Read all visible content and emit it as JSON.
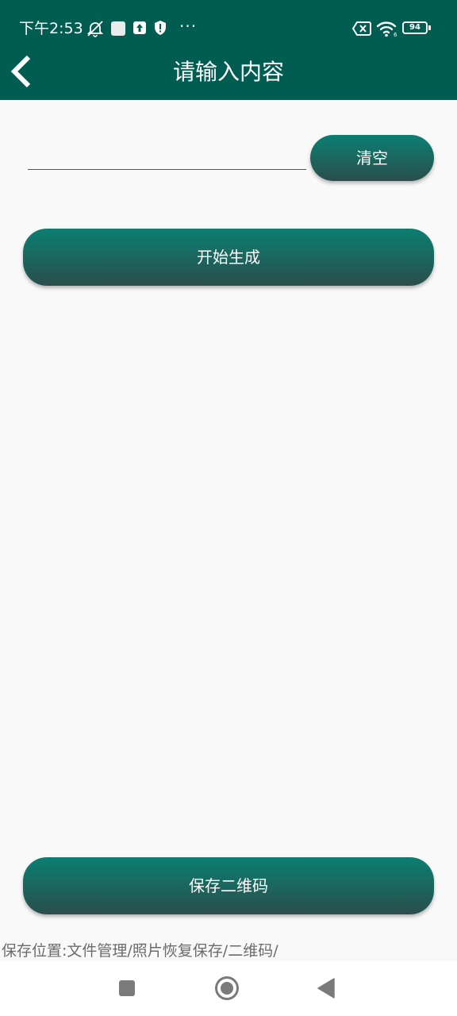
{
  "status_bar": {
    "time": "下午2:53",
    "more": "···",
    "battery_level": "94"
  },
  "header": {
    "title": "请输入内容"
  },
  "input": {
    "value": "",
    "placeholder": ""
  },
  "buttons": {
    "clear_label": "清空",
    "generate_label": "开始生成",
    "save_label": "保存二维码"
  },
  "footer": {
    "save_location": "保存位置:文件管理/照片恢复保存/二维码/"
  },
  "colors": {
    "app_bar": "#015c52",
    "button_top": "#0b7f72",
    "button_bottom": "#2a4e4b",
    "background": "#f9f9f9"
  },
  "icons": {
    "status": [
      "mute-bell-icon",
      "notification-square-icon",
      "upload-icon",
      "shield-icon",
      "sim-error-icon",
      "wifi-icon",
      "battery-icon"
    ],
    "back": "chevron-left-icon",
    "nav": [
      "recent-apps-icon",
      "home-icon",
      "back-triangle-icon"
    ]
  }
}
